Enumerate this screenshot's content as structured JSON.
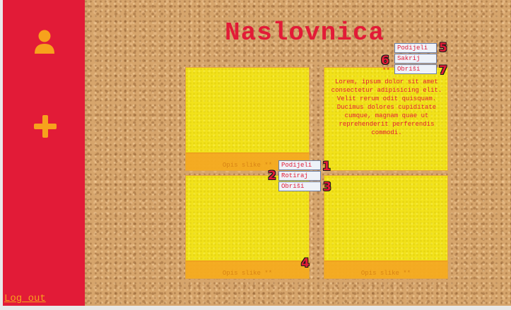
{
  "page": {
    "title": "Naslovnica"
  },
  "sidebar": {
    "user_icon": "user-icon",
    "add_icon": "plus-icon",
    "logout_label": "Log out",
    "colors": {
      "bg": "#e21b37",
      "icon": "#f7a21c"
    }
  },
  "notes": [
    {
      "caption": "Opis slike **"
    },
    {
      "text": "Lorem, ipsum dolor sit amet consectetur adipisicing elit. Velit rerum odit quisquam. Ducimus dolores cupiditate cumque, magnam quae ut reprehenderit perferendis commodi."
    },
    {
      "caption": "Opis slike **"
    },
    {
      "caption": "Opis slike **"
    }
  ],
  "menu_left": {
    "items": [
      "Podijeli",
      "Rotiraj",
      "Obriši"
    ]
  },
  "menu_right": {
    "items": [
      "Podijeli",
      "Sakrij",
      "Obriši"
    ],
    "dots": "**"
  },
  "badges": [
    "1",
    "2",
    "3",
    "4",
    "5",
    "6",
    "7"
  ]
}
